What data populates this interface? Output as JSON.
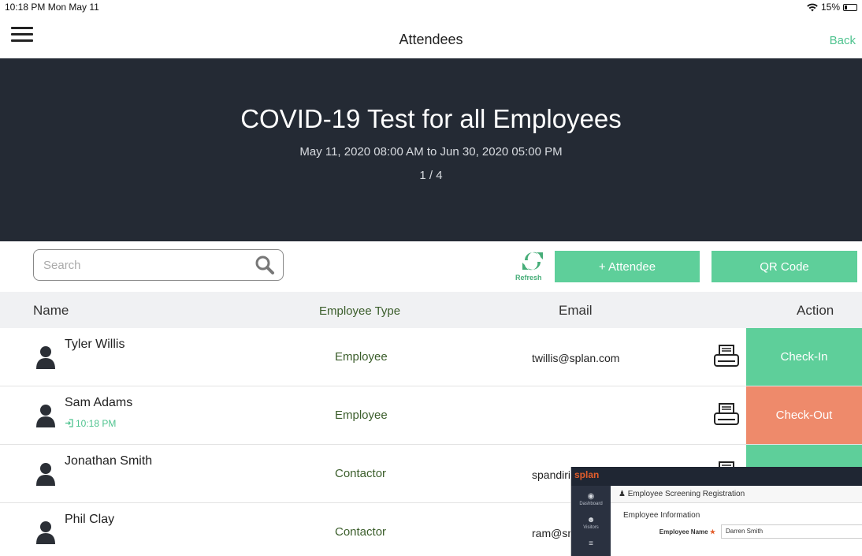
{
  "status_bar": {
    "time_date": "10:18 PM  Mon May 11",
    "battery": "15%"
  },
  "nav": {
    "title": "Attendees",
    "back_label": "Back"
  },
  "event": {
    "title": "COVID-19 Test for all Employees",
    "dates": "May 11, 2020 08:00 AM to Jun 30, 2020 05:00 PM",
    "page_indicator": "1 / 4"
  },
  "toolbar": {
    "search_placeholder": "Search",
    "refresh_label": "Refresh",
    "add_attendee_label": "+ Attendee",
    "qr_code_label": "QR Code"
  },
  "table": {
    "columns": {
      "name": "Name",
      "type": "Employee Type",
      "email": "Email",
      "action": "Action"
    },
    "rows": [
      {
        "name": "Tyler Willis",
        "checkin_time": "",
        "type": "Employee",
        "email": "twillis@splan.com",
        "action": "Check-In"
      },
      {
        "name": "Sam Adams",
        "checkin_time": "10:18 PM",
        "type": "Employee",
        "email": "",
        "action": "Check-Out"
      },
      {
        "name": "Jonathan Smith",
        "checkin_time": "",
        "type": "Contactor",
        "email": "spandiri@",
        "action": ""
      },
      {
        "name": "Phil Clay",
        "checkin_time": "",
        "type": "Contactor",
        "email": "ram@smai",
        "action": ""
      }
    ]
  },
  "overlay": {
    "logo": "splan",
    "sidebar": [
      {
        "label": "Dashboard"
      },
      {
        "label": "Visitors"
      },
      {
        "label": ""
      }
    ],
    "page_title": "Employee Screening Registration",
    "section": "Employee Information",
    "field_label": "Employee Name",
    "field_value": "Darren Smith"
  },
  "colors": {
    "accent_green": "#5ecf9a",
    "checkout_orange": "#ee8a6b",
    "hero_bg": "#242a34"
  }
}
